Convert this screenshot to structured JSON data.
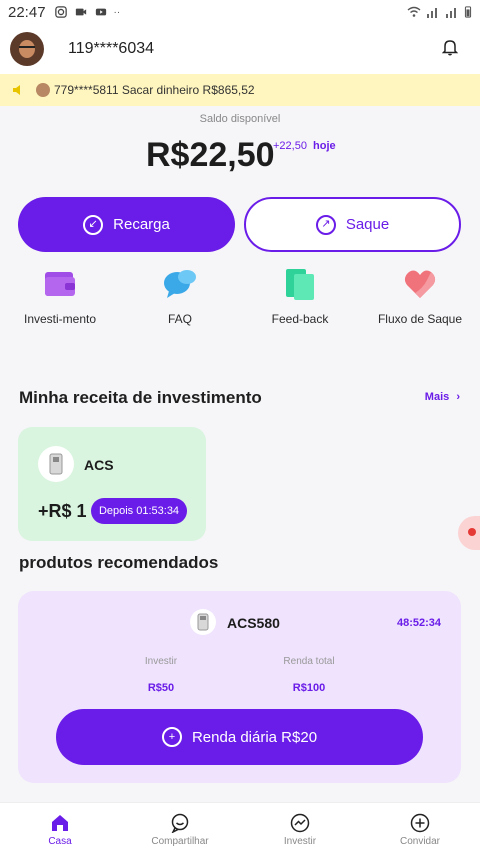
{
  "status_bar": {
    "time": "22:47"
  },
  "header": {
    "user_id": "119****6034"
  },
  "marquee": {
    "text": "779****5811 Sacar dinheiro R$865,52"
  },
  "balance": {
    "label": "Saldo disponível",
    "amount": "R$22,50",
    "delta": "+22,50",
    "today": "hoje"
  },
  "actions": {
    "recarga": "Recarga",
    "saque": "Saque"
  },
  "quick_links": [
    {
      "label": "Investi-mento",
      "icon": "wallet-icon"
    },
    {
      "label": "FAQ",
      "icon": "chat-bubbles-icon"
    },
    {
      "label": "Feed-back",
      "icon": "documents-icon"
    },
    {
      "label": "Fluxo de Saque",
      "icon": "heart-icon"
    }
  ],
  "income_section": {
    "title": "Minha receita de investimento",
    "more": "Mais"
  },
  "investment": {
    "name": "ACS",
    "amount": "+R$ 1",
    "timer": "Depois 01:53:34"
  },
  "products_section": {
    "title": "produtos recomendados"
  },
  "product": {
    "name": "ACS580",
    "timer": "48:52:34",
    "invest_label": "Investir",
    "invest_value": "R$50",
    "total_label": "Renda total",
    "total_value": "R$100",
    "button": "Renda diária R$20"
  },
  "tabs": [
    {
      "label": "Casa",
      "active": true
    },
    {
      "label": "Compartilhar",
      "active": false
    },
    {
      "label": "Investir",
      "active": false
    },
    {
      "label": "Convidar",
      "active": false
    }
  ],
  "colors": {
    "accent": "#6a1ce8",
    "card_green": "#d9f5df",
    "card_purple": "#efe3fd",
    "marquee_bg": "#fff6bf"
  }
}
